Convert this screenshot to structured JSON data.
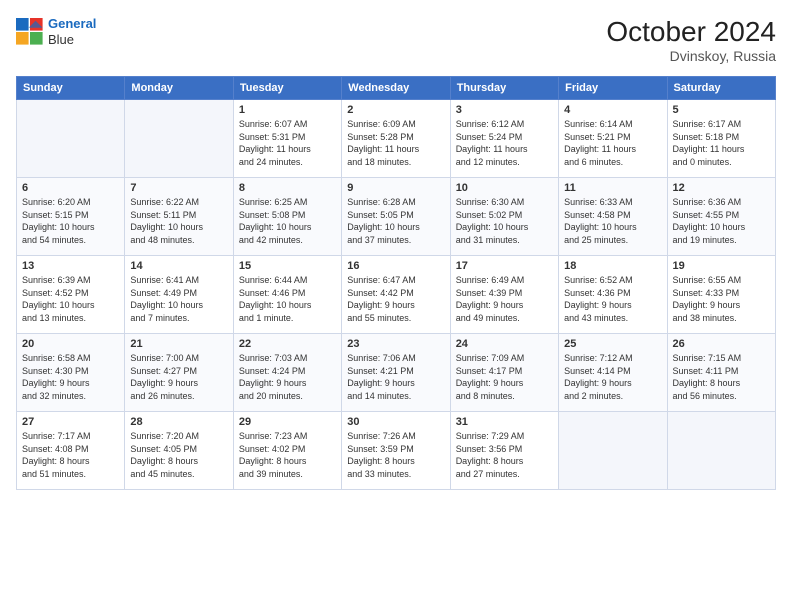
{
  "header": {
    "logo_line1": "General",
    "logo_line2": "Blue",
    "month": "October 2024",
    "location": "Dvinskoy, Russia"
  },
  "weekdays": [
    "Sunday",
    "Monday",
    "Tuesday",
    "Wednesday",
    "Thursday",
    "Friday",
    "Saturday"
  ],
  "weeks": [
    [
      {
        "day": "",
        "detail": ""
      },
      {
        "day": "",
        "detail": ""
      },
      {
        "day": "1",
        "detail": "Sunrise: 6:07 AM\nSunset: 5:31 PM\nDaylight: 11 hours\nand 24 minutes."
      },
      {
        "day": "2",
        "detail": "Sunrise: 6:09 AM\nSunset: 5:28 PM\nDaylight: 11 hours\nand 18 minutes."
      },
      {
        "day": "3",
        "detail": "Sunrise: 6:12 AM\nSunset: 5:24 PM\nDaylight: 11 hours\nand 12 minutes."
      },
      {
        "day": "4",
        "detail": "Sunrise: 6:14 AM\nSunset: 5:21 PM\nDaylight: 11 hours\nand 6 minutes."
      },
      {
        "day": "5",
        "detail": "Sunrise: 6:17 AM\nSunset: 5:18 PM\nDaylight: 11 hours\nand 0 minutes."
      }
    ],
    [
      {
        "day": "6",
        "detail": "Sunrise: 6:20 AM\nSunset: 5:15 PM\nDaylight: 10 hours\nand 54 minutes."
      },
      {
        "day": "7",
        "detail": "Sunrise: 6:22 AM\nSunset: 5:11 PM\nDaylight: 10 hours\nand 48 minutes."
      },
      {
        "day": "8",
        "detail": "Sunrise: 6:25 AM\nSunset: 5:08 PM\nDaylight: 10 hours\nand 42 minutes."
      },
      {
        "day": "9",
        "detail": "Sunrise: 6:28 AM\nSunset: 5:05 PM\nDaylight: 10 hours\nand 37 minutes."
      },
      {
        "day": "10",
        "detail": "Sunrise: 6:30 AM\nSunset: 5:02 PM\nDaylight: 10 hours\nand 31 minutes."
      },
      {
        "day": "11",
        "detail": "Sunrise: 6:33 AM\nSunset: 4:58 PM\nDaylight: 10 hours\nand 25 minutes."
      },
      {
        "day": "12",
        "detail": "Sunrise: 6:36 AM\nSunset: 4:55 PM\nDaylight: 10 hours\nand 19 minutes."
      }
    ],
    [
      {
        "day": "13",
        "detail": "Sunrise: 6:39 AM\nSunset: 4:52 PM\nDaylight: 10 hours\nand 13 minutes."
      },
      {
        "day": "14",
        "detail": "Sunrise: 6:41 AM\nSunset: 4:49 PM\nDaylight: 10 hours\nand 7 minutes."
      },
      {
        "day": "15",
        "detail": "Sunrise: 6:44 AM\nSunset: 4:46 PM\nDaylight: 10 hours\nand 1 minute."
      },
      {
        "day": "16",
        "detail": "Sunrise: 6:47 AM\nSunset: 4:42 PM\nDaylight: 9 hours\nand 55 minutes."
      },
      {
        "day": "17",
        "detail": "Sunrise: 6:49 AM\nSunset: 4:39 PM\nDaylight: 9 hours\nand 49 minutes."
      },
      {
        "day": "18",
        "detail": "Sunrise: 6:52 AM\nSunset: 4:36 PM\nDaylight: 9 hours\nand 43 minutes."
      },
      {
        "day": "19",
        "detail": "Sunrise: 6:55 AM\nSunset: 4:33 PM\nDaylight: 9 hours\nand 38 minutes."
      }
    ],
    [
      {
        "day": "20",
        "detail": "Sunrise: 6:58 AM\nSunset: 4:30 PM\nDaylight: 9 hours\nand 32 minutes."
      },
      {
        "day": "21",
        "detail": "Sunrise: 7:00 AM\nSunset: 4:27 PM\nDaylight: 9 hours\nand 26 minutes."
      },
      {
        "day": "22",
        "detail": "Sunrise: 7:03 AM\nSunset: 4:24 PM\nDaylight: 9 hours\nand 20 minutes."
      },
      {
        "day": "23",
        "detail": "Sunrise: 7:06 AM\nSunset: 4:21 PM\nDaylight: 9 hours\nand 14 minutes."
      },
      {
        "day": "24",
        "detail": "Sunrise: 7:09 AM\nSunset: 4:17 PM\nDaylight: 9 hours\nand 8 minutes."
      },
      {
        "day": "25",
        "detail": "Sunrise: 7:12 AM\nSunset: 4:14 PM\nDaylight: 9 hours\nand 2 minutes."
      },
      {
        "day": "26",
        "detail": "Sunrise: 7:15 AM\nSunset: 4:11 PM\nDaylight: 8 hours\nand 56 minutes."
      }
    ],
    [
      {
        "day": "27",
        "detail": "Sunrise: 7:17 AM\nSunset: 4:08 PM\nDaylight: 8 hours\nand 51 minutes."
      },
      {
        "day": "28",
        "detail": "Sunrise: 7:20 AM\nSunset: 4:05 PM\nDaylight: 8 hours\nand 45 minutes."
      },
      {
        "day": "29",
        "detail": "Sunrise: 7:23 AM\nSunset: 4:02 PM\nDaylight: 8 hours\nand 39 minutes."
      },
      {
        "day": "30",
        "detail": "Sunrise: 7:26 AM\nSunset: 3:59 PM\nDaylight: 8 hours\nand 33 minutes."
      },
      {
        "day": "31",
        "detail": "Sunrise: 7:29 AM\nSunset: 3:56 PM\nDaylight: 8 hours\nand 27 minutes."
      },
      {
        "day": "",
        "detail": ""
      },
      {
        "day": "",
        "detail": ""
      }
    ]
  ]
}
